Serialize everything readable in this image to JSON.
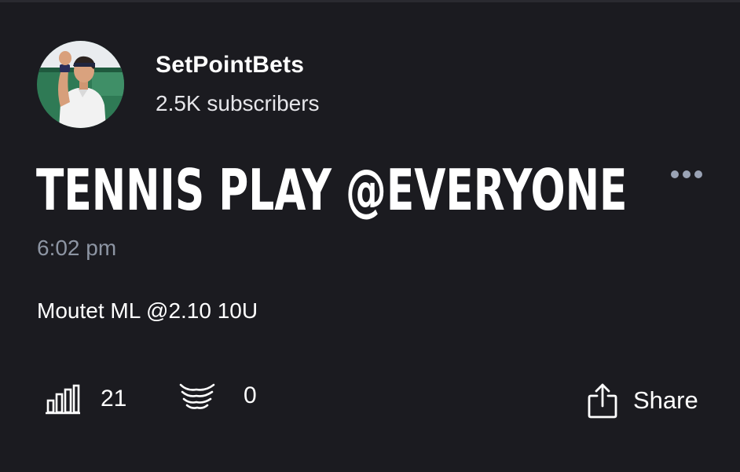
{
  "channel": {
    "name": "SetPointBets",
    "subscribers": "2.5K subscribers",
    "avatar_icon": "tennis-player-avatar"
  },
  "post": {
    "title": "TENNIS PLAY @EVERYONE",
    "time": "6:02 pm",
    "body": "Moutet ML @2.10 10U"
  },
  "stats": {
    "views_icon": "bar-chart-icon",
    "views": "21",
    "reactions_icon": "wings-icon",
    "reactions": "0"
  },
  "actions": {
    "more_icon": "more-dots-icon",
    "share_icon": "share-icon",
    "share_label": "Share"
  },
  "colors": {
    "background": "#1b1b20",
    "text": "#ffffff",
    "muted": "#8d95a3",
    "icon_muted": "#9aa3b5"
  }
}
